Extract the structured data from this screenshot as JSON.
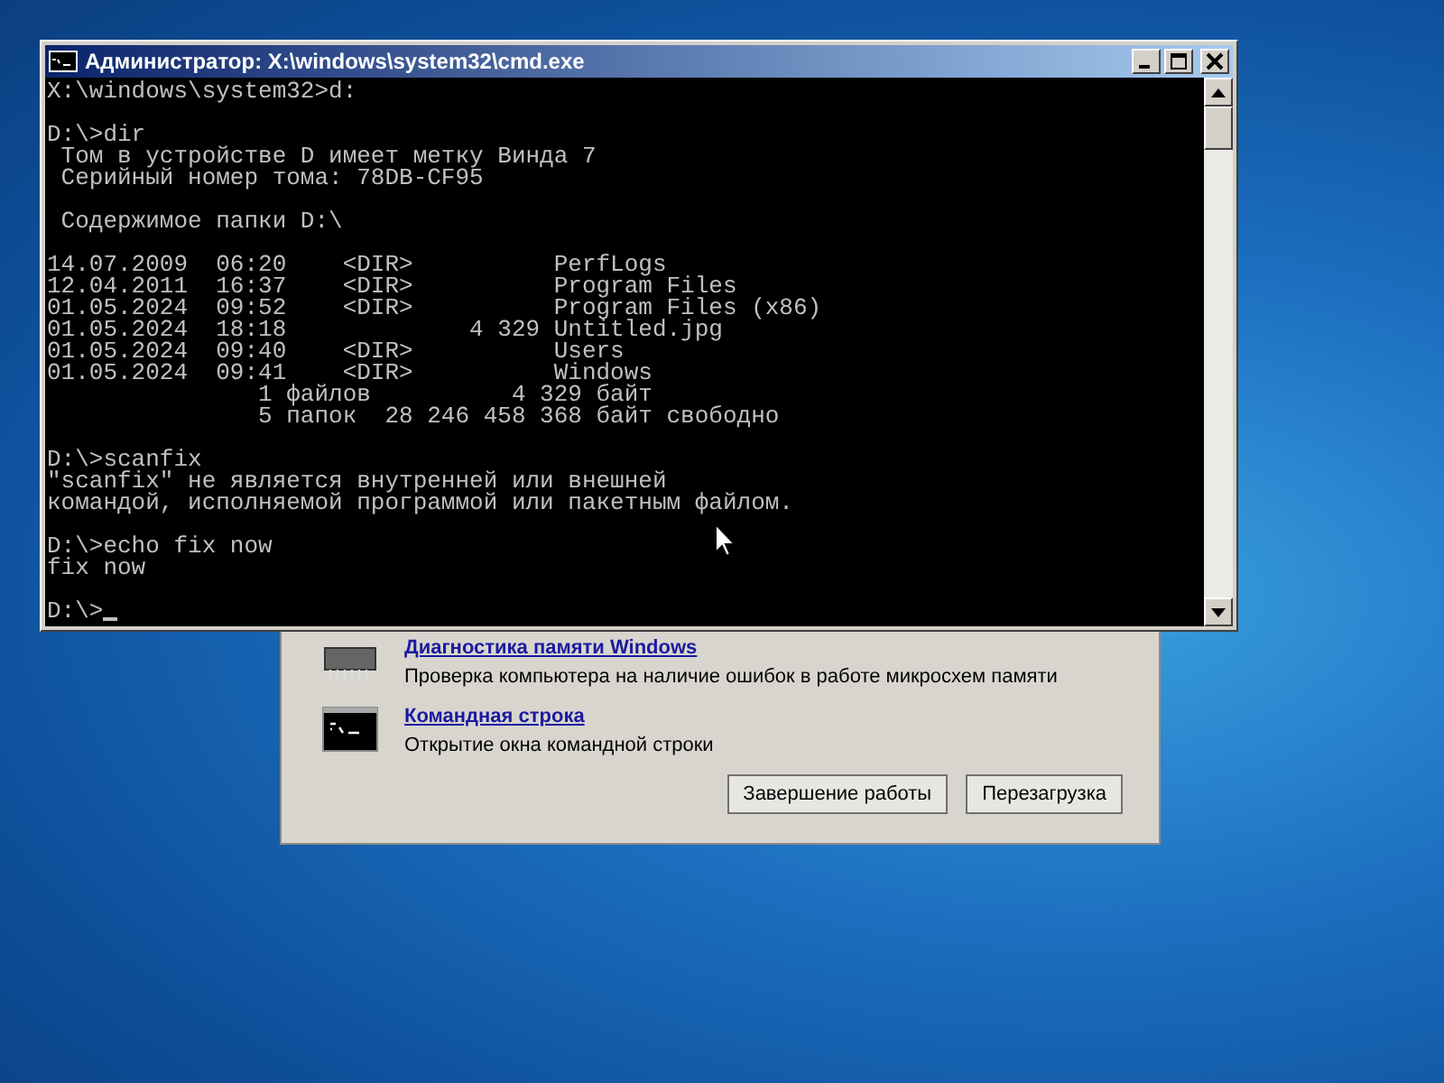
{
  "window": {
    "title": "Администратор: X:\\windows\\system32\\cmd.exe"
  },
  "console": {
    "blocks": [
      [
        "X:\\windows\\system32>d:"
      ],
      [
        "D:\\>dir",
        " Том в устройстве D имеет метку Винда 7",
        " Серийный номер тома: 78DB-CF95"
      ],
      [
        " Содержимое папки D:\\"
      ],
      [
        "14.07.2009  06:20    <DIR>          PerfLogs",
        "12.04.2011  16:37    <DIR>          Program Files",
        "01.05.2024  09:52    <DIR>          Program Files (x86)",
        "01.05.2024  18:18             4 329 Untitled.jpg",
        "01.05.2024  09:40    <DIR>          Users",
        "01.05.2024  09:41    <DIR>          Windows",
        "               1 файлов          4 329 байт",
        "               5 папок  28 246 458 368 байт свободно"
      ],
      [
        "D:\\>scanfix",
        "\"scanfix\" не является внутренней или внешней",
        "командой, исполняемой программой или пакетным файлом."
      ],
      [
        "D:\\>echo fix now",
        "fix now"
      ]
    ],
    "prompt": "D:\\>"
  },
  "recovery_dialog": {
    "options": [
      {
        "kind": "memory",
        "link": "Диагностика памяти Windows",
        "description": "Проверка компьютера на наличие ошибок в работе микросхем памяти"
      },
      {
        "kind": "cmd",
        "link": "Командная строка",
        "description": "Открытие окна командной строки"
      }
    ],
    "buttons": [
      "Завершение работы",
      "Перезагрузка"
    ]
  }
}
